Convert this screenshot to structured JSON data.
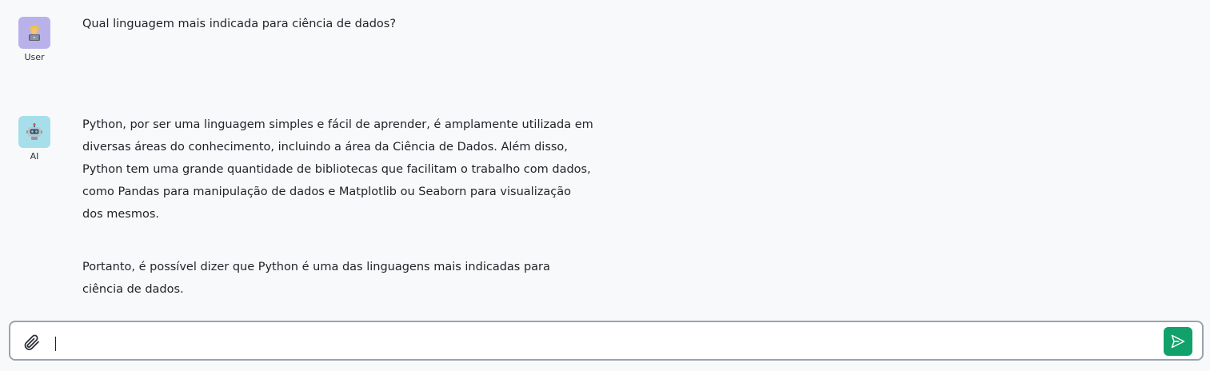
{
  "messages": [
    {
      "role": "user",
      "author_label": "User",
      "avatar_icon": "person-at-laptop-icon",
      "text": "Qual linguagem mais indicada para ciência de dados?"
    },
    {
      "role": "ai",
      "author_label": "AI",
      "avatar_icon": "robot-icon",
      "paragraphs": [
        "Python, por ser uma linguagem simples e fácil de aprender, é amplamente utilizada em diversas áreas do conhecimento, incluindo a área da Ciência de Dados. Além disso, Python tem uma grande quantidade de bibliotecas que facilitam o trabalho com dados, como Pandas para manipulação de dados e Matplotlib ou Seaborn para visualização dos mesmos.",
        "Portanto, é possível dizer que Python é uma das linguagens mais indicadas para ciência de dados."
      ]
    }
  ],
  "composer": {
    "value": "",
    "placeholder": "",
    "attach_icon": "paperclip-icon",
    "send_icon": "send-icon"
  },
  "colors": {
    "page_background": "#f8f9fb",
    "user_avatar_bg": "#b9b1ea",
    "ai_avatar_bg": "#a6dfea",
    "send_button": "#12a06b",
    "composer_border": "#9aa3ae"
  }
}
